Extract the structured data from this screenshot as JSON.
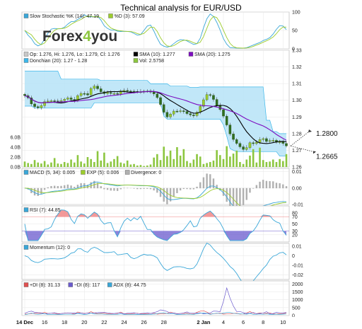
{
  "title": "Technical analysis for EUR/USD",
  "logo": {
    "part1": "Forex",
    "part2": "4",
    "part3": "you"
  },
  "colors": {
    "band_fill": "#b6e3f7",
    "band_line": "#3db7ea",
    "sma10": "#000000",
    "sma20": "#7d0fc0",
    "candle_up": "#9ccc2c",
    "candle_dn": "#2f6e1f",
    "volume": "#8cc63f",
    "slow_k": "#3aa7d8",
    "slow_d": "#9ccc2c",
    "macd": "#3aa7d8",
    "exp": "#9ccc2c",
    "divergence": "#b0b0b0",
    "rsi": "#3aa7d8",
    "momentum": "#3aa7d8",
    "pdi": "#e05050",
    "mdi": "#6a5acd",
    "adx": "#3aa7d8"
  },
  "annotations": {
    "upper": "1.2800",
    "lower": "1.2665"
  },
  "x_axis": {
    "labels": [
      "14 Dec",
      "16",
      "18",
      "20",
      "22",
      "24",
      "26",
      "28",
      "2 Jan",
      "4",
      "6",
      "8",
      "10"
    ],
    "label_index": [
      0,
      6,
      12,
      18,
      24,
      30,
      36,
      42,
      54,
      60,
      66,
      72,
      78
    ]
  },
  "panels": {
    "stoch": {
      "legend": [
        "Slow Stochastic %K (14): 47.19",
        "%D (3): 57.09"
      ],
      "ticks": [
        "100",
        "50",
        "0"
      ]
    },
    "price": {
      "legend": [
        "Op: 1.276, Hi: 1.276, Lo: 1.279, Cl: 1.276",
        "SMA (10): 1.277",
        "SMA (20): 1.275",
        "Donchian (20): 1.27 - 1.28",
        "Vol: 2.5758"
      ],
      "ticks": [
        "1.33",
        "1.32",
        "1.31",
        "1.30",
        "1.29",
        "1.28",
        "1.27",
        "1.26"
      ],
      "vol_ticks": [
        "6.0B",
        "4.0B",
        "2.0B",
        "0.0B"
      ]
    },
    "macd": {
      "legend": [
        "MACD (5, 34): 0.005",
        "EXP (5): 0.006",
        "Divergence: 0"
      ],
      "ticks": [
        "0.01",
        "0.00",
        "-0.01"
      ]
    },
    "rsi": {
      "legend": [
        "RSI (7): 44.85"
      ],
      "ticks": [
        "80",
        "70",
        "50",
        "30",
        "20"
      ]
    },
    "momentum": {
      "legend": [
        "Momentum (12): 0"
      ],
      "ticks": [
        "0.01",
        "0",
        "-0.01",
        "-0.02"
      ]
    },
    "adx": {
      "legend": [
        "+DI (8): 31.13",
        "−DI (8): 117",
        "ADX (8): 44.75"
      ],
      "ticks": [
        "2000",
        "1500",
        "1000",
        "500",
        "0"
      ]
    }
  },
  "chart_data": {
    "type": "line",
    "title": "Technical analysis for EUR/USD",
    "x_labels": [
      "14 Dec",
      "16",
      "18",
      "20",
      "22",
      "24",
      "26",
      "28",
      "2 Jan",
      "4",
      "6",
      "8",
      "10"
    ],
    "close": [
      1.3028,
      1.3015,
      1.2978,
      1.2962,
      1.2955,
      1.2968,
      1.2992,
      1.2995,
      1.2997,
      1.2996,
      1.2993,
      1.2998,
      1.3006,
      1.3014,
      1.3005,
      1.2998,
      1.3028,
      1.3041,
      1.304,
      1.3032,
      1.3071,
      1.3085,
      1.3069,
      1.3051,
      1.304,
      1.3047,
      1.3041,
      1.3041,
      1.3037,
      1.3054,
      1.3059,
      1.3055,
      1.3054,
      1.3053,
      1.305,
      1.3052,
      1.3055,
      1.3054,
      1.305,
      1.3038,
      1.3016,
      1.2974,
      1.2928,
      1.29,
      1.2917,
      1.2935,
      1.2934,
      1.2937,
      1.2933,
      1.292,
      1.2912,
      1.2908,
      1.2928,
      1.2964,
      1.3003,
      1.3034,
      1.303,
      1.3005,
      1.2969,
      1.2944,
      1.2905,
      1.2852,
      1.2798,
      1.2765,
      1.2741,
      1.2721,
      1.2705,
      1.2716,
      1.2745,
      1.274,
      1.2748,
      1.2764,
      1.277,
      1.2753,
      1.2758,
      1.276,
      1.2748,
      1.2751,
      1.2741,
      1.2726
    ],
    "donchian_upper": [
      1.3175,
      1.3175,
      1.3175,
      1.3175,
      1.3175,
      1.3175,
      1.3175,
      1.3175,
      1.3175,
      1.3175,
      1.3175,
      1.3127,
      1.3127,
      1.3127,
      1.3127,
      1.3127,
      1.3127,
      1.3127,
      1.3127,
      1.3127,
      1.3127,
      1.3127,
      1.3127,
      1.3119,
      1.3119,
      1.3119,
      1.3119,
      1.3119,
      1.3119,
      1.3119,
      1.3119,
      1.3119,
      1.3119,
      1.3119,
      1.3119,
      1.3119,
      1.3119,
      1.3119,
      1.3099,
      1.3099,
      1.3099,
      1.3099,
      1.3099,
      1.3099,
      1.3085,
      1.3085,
      1.3085,
      1.3085,
      1.3085,
      1.3085,
      1.3077,
      1.3077,
      1.3077,
      1.308,
      1.308,
      1.308,
      1.308,
      1.308,
      1.308,
      1.308,
      1.308,
      1.308,
      1.308,
      1.308,
      1.308,
      1.308,
      1.308,
      1.308,
      1.308,
      1.308,
      1.308,
      1.308,
      1.308,
      1.288,
      1.288,
      1.2812,
      1.2812,
      1.28,
      1.28,
      1.28
    ],
    "donchian_lower": [
      1.2965,
      1.2965,
      1.2965,
      1.2953,
      1.2953,
      1.2953,
      1.2953,
      1.2953,
      1.2953,
      1.2953,
      1.2953,
      1.2953,
      1.2953,
      1.2953,
      1.2953,
      1.2953,
      1.2953,
      1.2953,
      1.2953,
      1.2953,
      1.2953,
      1.2985,
      1.2985,
      1.2985,
      1.2985,
      1.2985,
      1.2985,
      1.2985,
      1.2985,
      1.2985,
      1.2985,
      1.2985,
      1.2985,
      1.2985,
      1.2985,
      1.2985,
      1.2985,
      1.2985,
      1.2985,
      1.2985,
      1.2985,
      1.2985,
      1.2905,
      1.2887,
      1.2887,
      1.2887,
      1.2887,
      1.2887,
      1.2887,
      1.2887,
      1.2887,
      1.2887,
      1.2887,
      1.2887,
      1.2887,
      1.2887,
      1.2887,
      1.2887,
      1.2887,
      1.2887,
      1.2852,
      1.2785,
      1.271,
      1.27,
      1.2692,
      1.2692,
      1.2692,
      1.2692,
      1.2692,
      1.2692,
      1.2692,
      1.2692,
      1.2692,
      1.2692,
      1.2692,
      1.2692,
      1.2692,
      1.2665,
      1.2665,
      1.2665
    ],
    "volume_b": [
      1.1,
      0.8,
      0.6,
      1.4,
      0.9,
      0.7,
      1.2,
      0.5,
      0.9,
      1.8,
      0.7,
      0.6,
      1.0,
      0.8,
      1.5,
      0.9,
      2.4,
      1.1,
      0.7,
      2.0,
      1.6,
      1.0,
      3.2,
      1.3,
      2.9,
      0.8,
      1.1,
      1.6,
      2.2,
      0.9,
      0.7,
      1.3,
      0.5,
      0.6,
      0.3,
      0.4,
      0.2,
      0.3,
      0.5,
      1.9,
      2.6,
      1.4,
      4.1,
      2.2,
      3.3,
      1.6,
      4.0,
      2.3,
      3.6,
      1.2,
      0.8,
      1.5,
      2.6,
      2.1,
      0.6,
      0.8,
      1.0,
      1.3,
      3.4,
      2.4,
      1.6,
      4.2,
      2.1,
      2.7,
      3.3,
      1.0,
      0.6,
      1.5,
      2.3,
      3.6,
      0.9,
      3.9,
      1.4,
      1.0,
      1.1,
      1.5,
      1.0,
      1.6,
      1.2,
      2.6
    ],
    "ylim_price": [
      1.26,
      1.33
    ],
    "ylim_volume_b": [
      0,
      6
    ],
    "ylim_stoch": [
      0,
      100
    ],
    "ylim_macd": [
      -0.01,
      0.012
    ],
    "ylim_rsi": [
      0,
      100
    ],
    "ylim_momentum": [
      -0.025,
      0.013
    ],
    "ylim_adx": [
      0,
      2200
    ],
    "xlabel": "",
    "ylabel": "",
    "grid": true
  }
}
